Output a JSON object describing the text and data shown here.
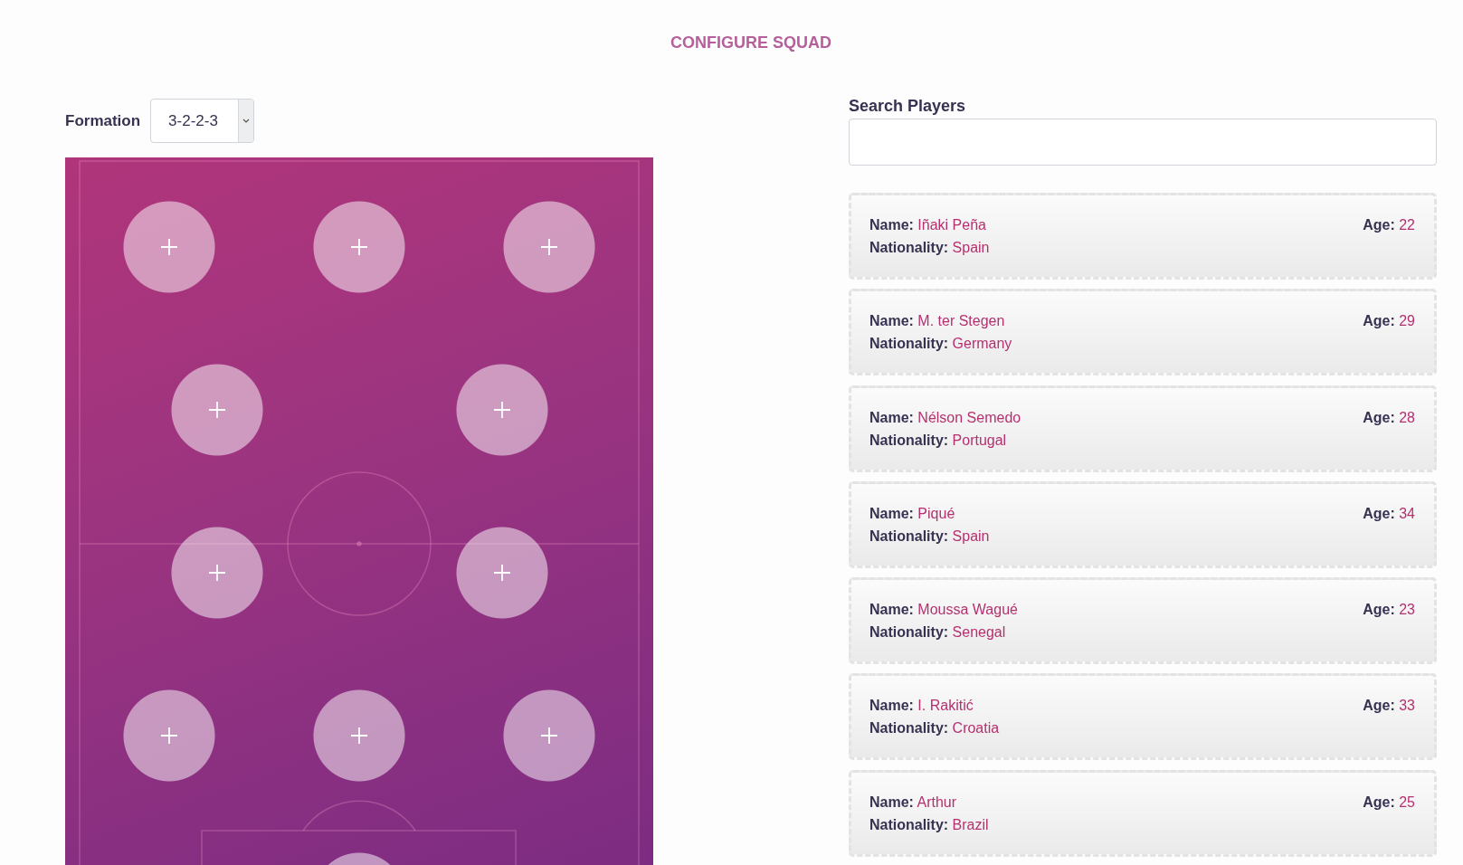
{
  "title": "CONFIGURE SQUAD",
  "formation": {
    "label": "Formation",
    "value": "3-2-2-3"
  },
  "pitch": {
    "rows": [
      {
        "slots": [
          {
            "filled": false
          },
          {
            "filled": false
          },
          {
            "filled": false
          }
        ]
      },
      {
        "slots": [
          {
            "filled": false
          },
          {
            "filled": false
          }
        ]
      },
      {
        "slots": [
          {
            "filled": false
          },
          {
            "filled": false
          }
        ]
      },
      {
        "slots": [
          {
            "filled": false
          },
          {
            "filled": false
          },
          {
            "filled": false
          }
        ]
      },
      {
        "slots": [
          {
            "filled": false
          }
        ]
      }
    ]
  },
  "search": {
    "label": "Search Players"
  },
  "players": [
    {
      "name": "**Name:** Iñaki Peña",
      "nationality": "**Nationality:** Spain",
      "age": "**Age:** 22"
    },
    {
      "name": "**Name:** M. ter Stegen",
      "nationality": "**Nationality:** Germany",
      "age": "**Age:** 29"
    },
    {
      "name": "**Name:** Nélson Semedo",
      "nationality": "**Nationality:** Portugal",
      "age": "**Age:** 28"
    },
    {
      "name": "**Name:** Piqué",
      "nationality": "**Nationality:** Spain",
      "age": "**Age:** 34"
    },
    {
      "name": "**Name:** Moussa Wagué",
      "nationality": "**Nationality:** Senegal",
      "age": "**Age:** 23"
    },
    {
      "name": "**Name:** I. Rakitić",
      "nationality": "**Nationality:** Croatia",
      "age": "**Age:** 33"
    },
    {
      "name": "**Name:** Arthur",
      "nationality": "**Nationality:** Brazil",
      "age": "**Age:** 25"
    }
  ]
}
